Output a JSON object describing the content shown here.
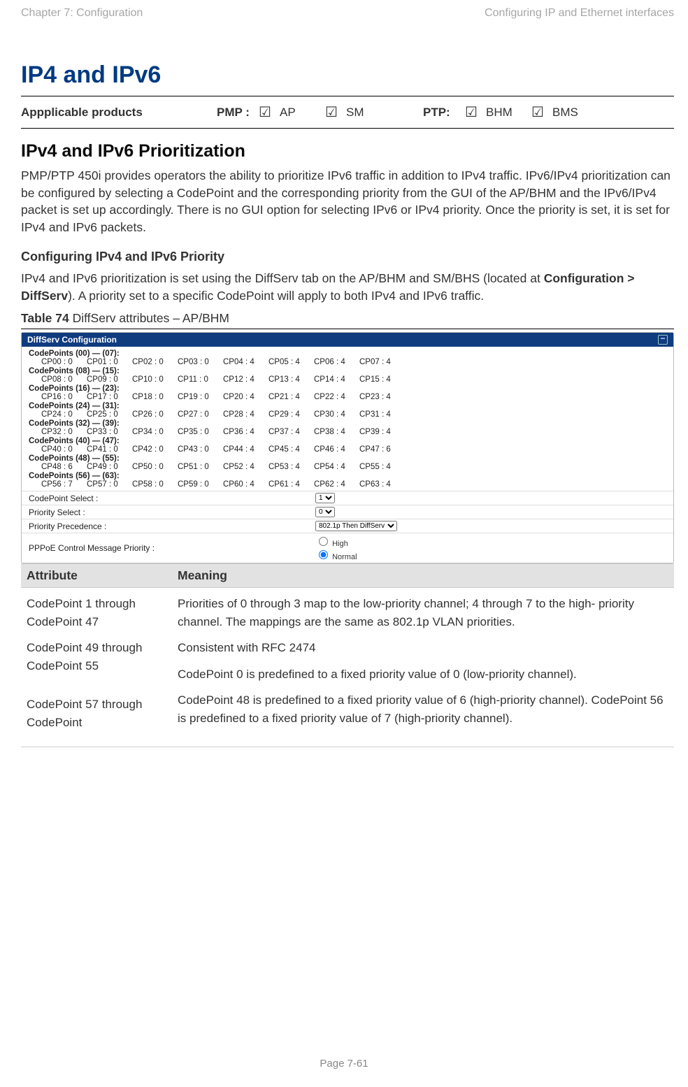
{
  "header": {
    "left": "Chapter 7:  Configuration",
    "right": "Configuring IP and Ethernet interfaces"
  },
  "title": "IP4 and IPv6",
  "applicable": {
    "label": "Appplicable products",
    "pmp_label": "PMP :",
    "ptp_label": "PTP:",
    "cb_ap": "☑",
    "ap": "AP",
    "cb_sm": "☑",
    "sm": "SM",
    "cb_bhm": "☑",
    "bhm": "BHM",
    "cb_bms": "☑",
    "bms": "BMS"
  },
  "h2": "IPv4 and IPv6 Prioritization",
  "p1": "PMP/PTP 450i provides operators the ability to prioritize IPv6 traffic in addition to IPv4 traffic. IPv6/IPv4 prioritization can be configured by selecting a CodePoint and the corresponding priority from the GUI of the AP/BHM and the IPv6/IPv4 packet is set up accordingly. There is no GUI option for selecting IPv6 or IPv4 priority. Once the priority is set, it is set for IPv4 and IPv6 packets.",
  "h3": "Configuring IPv4 and IPv6 Priority",
  "p2_pre": "IPv4 and IPv6 prioritization is set using the DiffServ tab on the AP/BHM and SM/BHS (located at ",
  "p2_b": "Configuration > DiffServ",
  "p2_post": "). A priority set to a specific CodePoint will apply to both IPv4 and IPv6 traffic.",
  "table_ref_b": "Table 74",
  "table_ref_t": " DiffServ attributes – AP/BHM",
  "diffserv": {
    "title": "DiffServ Configuration",
    "groups": [
      {
        "label": "CodePoints (00) — (07):",
        "items": [
          "CP00 : 0",
          "CP01 : 0",
          "CP02 : 0",
          "CP03 : 0",
          "CP04 : 4",
          "CP05 : 4",
          "CP06 : 4",
          "CP07 : 4"
        ]
      },
      {
        "label": "CodePoints (08) — (15):",
        "items": [
          "CP08 : 0",
          "CP09 : 0",
          "CP10 : 0",
          "CP11 : 0",
          "CP12 : 4",
          "CP13 : 4",
          "CP14 : 4",
          "CP15 : 4"
        ]
      },
      {
        "label": "CodePoints (16) — (23):",
        "items": [
          "CP16 : 0",
          "CP17 : 0",
          "CP18 : 0",
          "CP19 : 0",
          "CP20 : 4",
          "CP21 : 4",
          "CP22 : 4",
          "CP23 : 4"
        ]
      },
      {
        "label": "CodePoints (24) — (31):",
        "items": [
          "CP24 : 0",
          "CP25 : 0",
          "CP26 : 0",
          "CP27 : 0",
          "CP28 : 4",
          "CP29 : 4",
          "CP30 : 4",
          "CP31 : 4"
        ]
      },
      {
        "label": "CodePoints (32) — (39):",
        "items": [
          "CP32 : 0",
          "CP33 : 0",
          "CP34 : 0",
          "CP35 : 0",
          "CP36 : 4",
          "CP37 : 4",
          "CP38 : 4",
          "CP39 : 4"
        ]
      },
      {
        "label": "CodePoints (40) — (47):",
        "items": [
          "CP40 : 0",
          "CP41 : 0",
          "CP42 : 0",
          "CP43 : 0",
          "CP44 : 4",
          "CP45 : 4",
          "CP46 : 4",
          "CP47 : 6"
        ]
      },
      {
        "label": "CodePoints (48) — (55):",
        "items": [
          "CP48 : 6",
          "CP49 : 0",
          "CP50 : 0",
          "CP51 : 0",
          "CP52 : 4",
          "CP53 : 4",
          "CP54 : 4",
          "CP55 : 4"
        ]
      },
      {
        "label": "CodePoints (56) — (63):",
        "items": [
          "CP56 : 7",
          "CP57 : 0",
          "CP58 : 0",
          "CP59 : 0",
          "CP60 : 4",
          "CP61 : 4",
          "CP62 : 4",
          "CP63 : 4"
        ]
      }
    ],
    "rows": {
      "r1": {
        "label": "CodePoint Select :",
        "value": "1"
      },
      "r2": {
        "label": "Priority Select :",
        "value": "0"
      },
      "r3": {
        "label": "Priority Precedence :",
        "value": "802.1p Then DiffServ"
      },
      "r4": {
        "label": "PPPoE Control Message Priority :",
        "opt1": "High",
        "opt2": "Normal"
      }
    }
  },
  "attr_head": {
    "c1": "Attribute",
    "c2": "Meaning"
  },
  "attrs": {
    "col1": {
      "p1": "CodePoint 1 through CodePoint 47",
      "p2": "CodePoint 49 through CodePoint 55",
      "p3": "CodePoint 57 through CodePoint"
    },
    "col2": {
      "p1": "Priorities of 0 through 3 map to the low-priority channel; 4 through 7 to the high- priority channel. The mappings are the same as 802.1p VLAN priorities.",
      "p2": "Consistent with RFC 2474",
      "p3": "CodePoint 0 is predefined to a fixed priority value of 0 (low-priority channel).",
      "p4": "CodePoint 48 is predefined to a fixed priority value of 6 (high-priority channel). CodePoint 56 is predefined to a fixed priority value of 7 (high-priority channel)."
    }
  },
  "footer": "Page 7-61"
}
